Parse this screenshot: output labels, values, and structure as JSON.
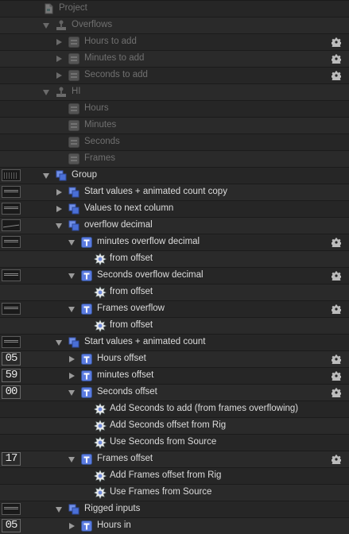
{
  "layers": [
    {
      "label": "Project",
      "depth": 0,
      "icon": "document-icon",
      "disclosure": "none",
      "dim": true,
      "gear": false
    },
    {
      "label": "Overflows",
      "depth": 1,
      "icon": "rig-icon",
      "disclosure": "open",
      "dim": true,
      "gear": false
    },
    {
      "label": "Hours to add",
      "depth": 2,
      "icon": "widget-icon",
      "disclosure": "closed",
      "dim": true,
      "gear": true
    },
    {
      "label": "Minutes to add",
      "depth": 2,
      "icon": "widget-icon",
      "disclosure": "closed",
      "dim": true,
      "gear": true
    },
    {
      "label": "Seconds to add",
      "depth": 2,
      "icon": "widget-icon",
      "disclosure": "closed",
      "dim": true,
      "gear": true
    },
    {
      "label": "HI",
      "depth": 1,
      "icon": "rig-icon",
      "disclosure": "open",
      "dim": true,
      "gear": false
    },
    {
      "label": "Hours",
      "depth": 2,
      "icon": "widget-icon",
      "disclosure": "none",
      "dim": true,
      "gear": false
    },
    {
      "label": "Minutes",
      "depth": 2,
      "icon": "widget-icon",
      "disclosure": "none",
      "dim": true,
      "gear": false
    },
    {
      "label": "Seconds",
      "depth": 2,
      "icon": "widget-icon",
      "disclosure": "none",
      "dim": true,
      "gear": false
    },
    {
      "label": "Frames",
      "depth": 2,
      "icon": "widget-icon",
      "disclosure": "none",
      "dim": true,
      "gear": false
    },
    {
      "label": "Group",
      "depth": 1,
      "icon": "group-icon",
      "disclosure": "open",
      "dim": false,
      "gear": false,
      "thumb": "dots"
    },
    {
      "label": "Start values + animated count copy",
      "depth": 2,
      "icon": "group-icon",
      "disclosure": "closed",
      "dim": false,
      "gear": false,
      "thumb": "tc"
    },
    {
      "label": "Values to next column",
      "depth": 2,
      "icon": "group-icon",
      "disclosure": "closed",
      "dim": false,
      "gear": false,
      "thumb": "tc"
    },
    {
      "label": "overflow decimal",
      "depth": 2,
      "icon": "group-icon",
      "disclosure": "open",
      "dim": false,
      "gear": false,
      "thumb": "wave"
    },
    {
      "label": "minutes overflow decimal",
      "depth": 3,
      "icon": "text-layer-icon",
      "disclosure": "open",
      "dim": false,
      "gear": true,
      "thumb": "tc"
    },
    {
      "label": "from offset",
      "depth": 4,
      "icon": "behavior-icon",
      "disclosure": "none",
      "dim": false,
      "gear": false
    },
    {
      "label": "Seconds overflow decimal",
      "depth": 3,
      "icon": "text-layer-icon",
      "disclosure": "open",
      "dim": false,
      "gear": true,
      "thumb": "tc"
    },
    {
      "label": "from offset",
      "depth": 4,
      "icon": "behavior-icon",
      "disclosure": "none",
      "dim": false,
      "gear": false
    },
    {
      "label": "Frames overflow",
      "depth": 3,
      "icon": "text-layer-icon",
      "disclosure": "open",
      "dim": false,
      "gear": true,
      "thumb": "tc"
    },
    {
      "label": "from offset",
      "depth": 4,
      "icon": "behavior-icon",
      "disclosure": "none",
      "dim": false,
      "gear": false
    },
    {
      "label": "Start values + animated count",
      "depth": 2,
      "icon": "group-icon",
      "disclosure": "open",
      "dim": false,
      "gear": false,
      "thumb": "tc"
    },
    {
      "label": "Hours offset",
      "depth": 3,
      "icon": "text-layer-icon",
      "disclosure": "closed",
      "dim": false,
      "gear": true,
      "num": "05"
    },
    {
      "label": "minutes offset",
      "depth": 3,
      "icon": "text-layer-icon",
      "disclosure": "closed",
      "dim": false,
      "gear": true,
      "num": "59"
    },
    {
      "label": "Seconds offset",
      "depth": 3,
      "icon": "text-layer-icon",
      "disclosure": "open",
      "dim": false,
      "gear": true,
      "num": "00"
    },
    {
      "label": "Add Seconds to add (from frames overflowing)",
      "depth": 4,
      "icon": "behavior-icon",
      "disclosure": "none",
      "dim": false,
      "gear": false
    },
    {
      "label": "Add Seconds offset from Rig",
      "depth": 4,
      "icon": "behavior-icon",
      "disclosure": "none",
      "dim": false,
      "gear": false
    },
    {
      "label": "Use Seconds from Source",
      "depth": 4,
      "icon": "behavior-icon",
      "disclosure": "none",
      "dim": false,
      "gear": false
    },
    {
      "label": "Frames offset",
      "depth": 3,
      "icon": "text-layer-icon",
      "disclosure": "open",
      "dim": false,
      "gear": true,
      "num": "17"
    },
    {
      "label": "Add Frames offset from Rig",
      "depth": 4,
      "icon": "behavior-icon",
      "disclosure": "none",
      "dim": false,
      "gear": false
    },
    {
      "label": "Use Frames from Source",
      "depth": 4,
      "icon": "behavior-icon",
      "disclosure": "none",
      "dim": false,
      "gear": false
    },
    {
      "label": "Rigged inputs",
      "depth": 2,
      "icon": "group-icon",
      "disclosure": "open",
      "dim": false,
      "gear": false,
      "thumb": "tc"
    },
    {
      "label": "Hours in",
      "depth": 3,
      "icon": "text-layer-icon",
      "disclosure": "closed",
      "dim": false,
      "gear": false,
      "num": "05"
    }
  ],
  "colors": {
    "background": "#262626",
    "text": "#dcdcdc",
    "dim_text": "#707070",
    "group_blue": "#4a6fd6",
    "text_layer_blue": "#5b7be0"
  }
}
